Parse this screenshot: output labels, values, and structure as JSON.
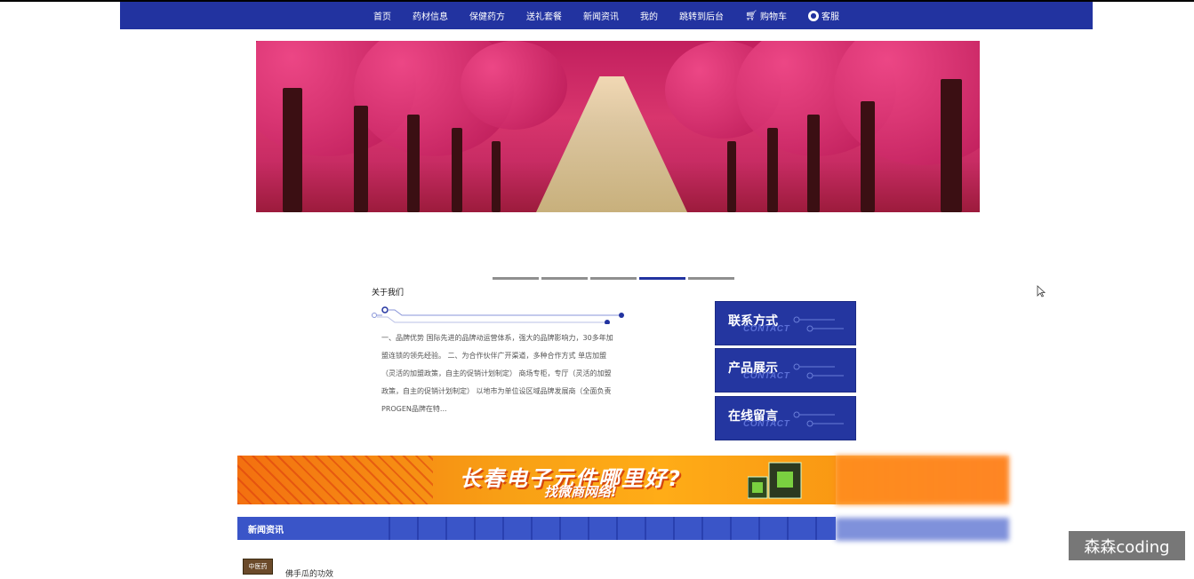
{
  "nav": {
    "items": [
      {
        "label": "首页"
      },
      {
        "label": "药材信息"
      },
      {
        "label": "保健药方"
      },
      {
        "label": "送礼套餐"
      },
      {
        "label": "新闻资讯"
      },
      {
        "label": "我的"
      },
      {
        "label": "跳转到后台"
      },
      {
        "label": "购物车",
        "icon": "cart-icon"
      },
      {
        "label": "客服",
        "icon": "chat-icon"
      }
    ]
  },
  "carousel": {
    "dot_count": 5,
    "active_index": 3
  },
  "about": {
    "title": "关于我们",
    "text": "一、品牌优势 国际先进的品牌动运营体系，强大的品牌影响力，30多年加盟连锁的领先经验。 二、为合作伙伴广开渠道，多种合作方式 单店加盟（灵活的加盟政策，自主的促销计划制定） 商场专柜，专厅（灵活的加盟政策，自主的促销计划制定） 以地市为单位设区域品牌发展商（全面负责PROGEN品牌在特..."
  },
  "side_buttons": [
    {
      "label": "联系方式",
      "sub": "CONTACT"
    },
    {
      "label": "产品展示",
      "sub": "CONTACT"
    },
    {
      "label": "在线留言",
      "sub": "CONTACT"
    }
  ],
  "ad": {
    "headline": "长春电子元件哪里好?",
    "subline": "找微商网络!"
  },
  "news": {
    "title": "新闻资讯",
    "items": [
      {
        "thumb_text": "中医药",
        "title": "佛手瓜的功效"
      }
    ]
  },
  "watermark": "森森coding",
  "colors": {
    "nav_bg": "#2233a0",
    "button_bg": "#2436a0",
    "news_bar_bg": "#3a55c8",
    "ad_orange": "#f8a015"
  }
}
